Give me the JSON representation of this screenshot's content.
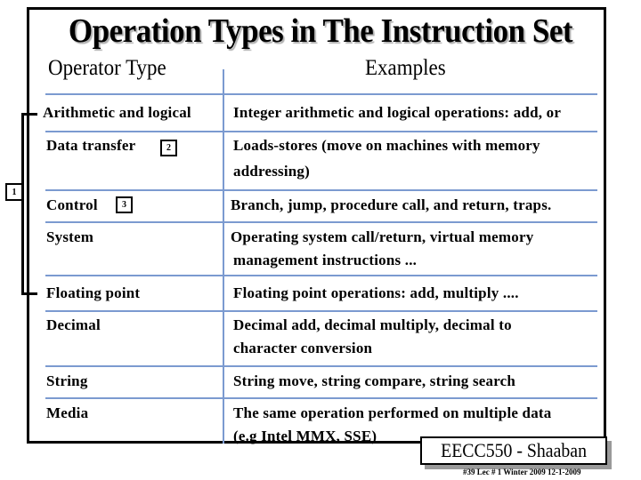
{
  "slide": {
    "title": "Operation Types in The Instruction Set",
    "columns": {
      "operator_type": "Operator Type",
      "examples": "Examples"
    },
    "rows": [
      {
        "type": "Arithmetic and logical",
        "example_lines": [
          "Integer arithmetic and logical operations: add, or"
        ]
      },
      {
        "type": "Data transfer",
        "badge": "2",
        "example_lines": [
          "Loads-stores  (move on machines with memory",
          "addressing)"
        ]
      },
      {
        "type": "Control",
        "badge": "3",
        "example_lines": [
          "Branch, jump, procedure call, and return, traps."
        ]
      },
      {
        "type": "System",
        "example_lines": [
          "Operating system call/return, virtual memory",
          "management instructions ..."
        ]
      },
      {
        "type": "Floating point",
        "example_lines": [
          "Floating point operations: add, multiply ...."
        ]
      },
      {
        "type": "Decimal",
        "example_lines": [
          "Decimal add, decimal multiply, decimal to",
          "character conversion"
        ]
      },
      {
        "type": "String",
        "example_lines": [
          "String move, string compare, string search"
        ]
      },
      {
        "type": "Media",
        "example_lines": [
          "The same operation performed on multiple data",
          " (e.g Intel MMX, SSE)"
        ]
      }
    ],
    "group_badge": "1",
    "footer": {
      "course": "EECC550 - Shaaban",
      "meta": "#39   Lec # 1  Winter 2009  12-1-2009"
    },
    "colors": {
      "rule": "#7b9ad0",
      "border": "#000000",
      "shadow": "#9a9a9a"
    }
  }
}
